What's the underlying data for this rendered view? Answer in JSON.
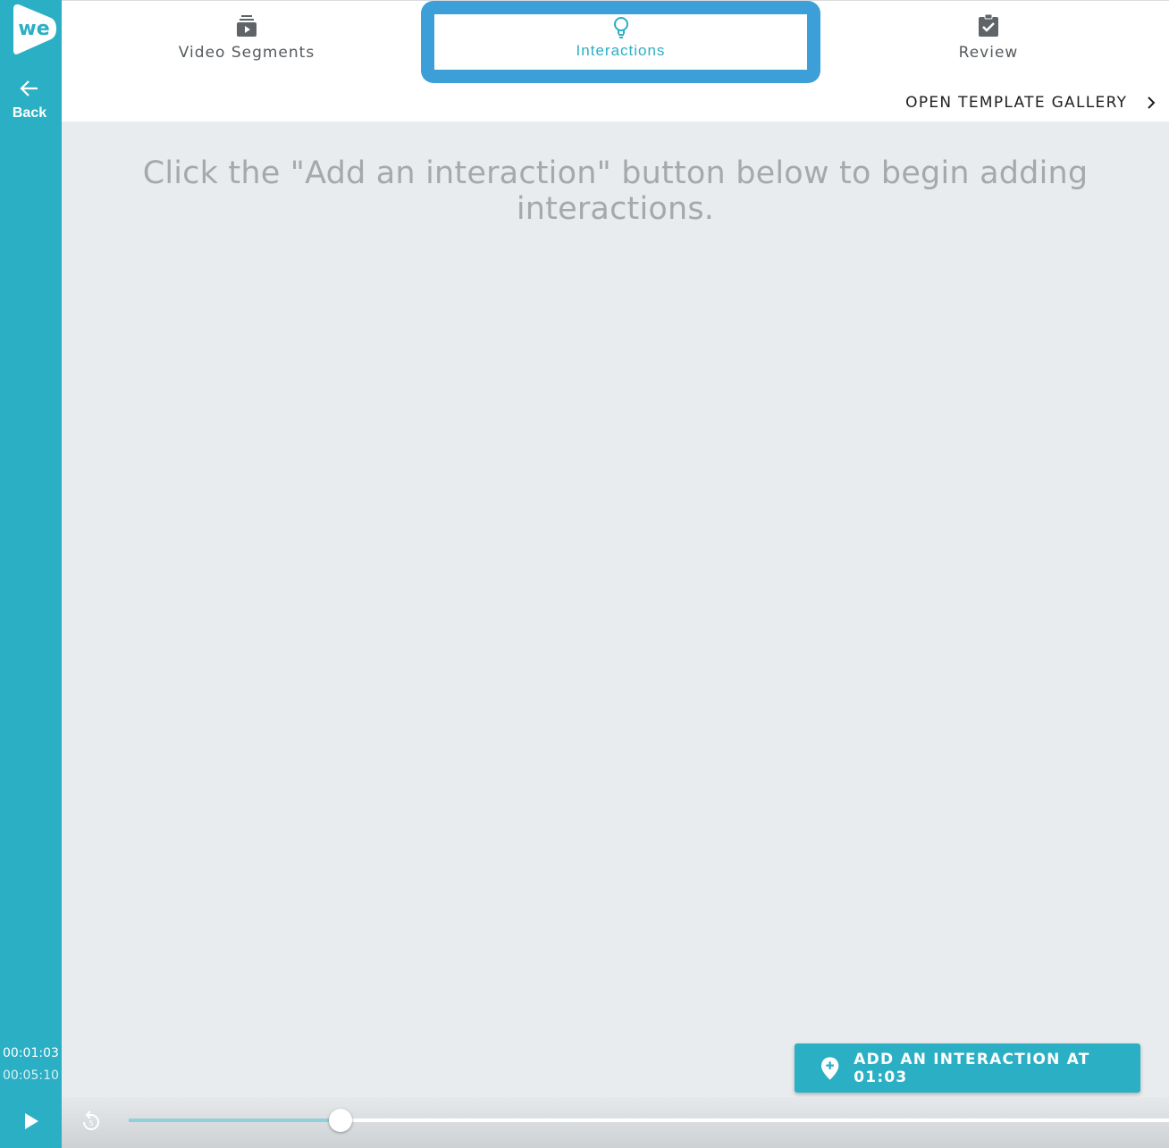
{
  "brand": {
    "logo_text": "we",
    "accent": "#2bafc4",
    "highlight": "#3d9fd8"
  },
  "sidebar": {
    "back_label": "Back",
    "back_icon": "arrow-left-icon"
  },
  "tabs": [
    {
      "label": "Video Segments",
      "icon": "video-stack-icon",
      "active": false
    },
    {
      "label": "Interactions",
      "icon": "lightbulb-icon",
      "active": true
    },
    {
      "label": "Review",
      "icon": "clipboard-check-icon",
      "active": false
    }
  ],
  "gallery_link": {
    "label": "OPEN TEMPLATE GALLERY",
    "icon": "chevron-right-icon"
  },
  "main": {
    "empty_hint": "Click the \"Add an interaction\" button below to begin adding interactions."
  },
  "add_button": {
    "label": "ADD AN INTERACTION AT 01:03",
    "icon": "map-pin-plus-icon"
  },
  "player": {
    "current_time": "00:01:03",
    "total_time": "00:05:10",
    "progress": 0.2032,
    "play_icon": "play-icon",
    "replay_icon": "replay-5-icon"
  }
}
